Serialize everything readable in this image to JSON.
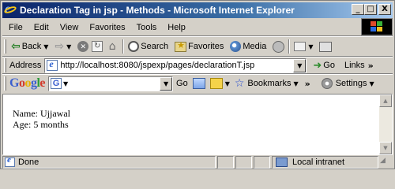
{
  "window": {
    "title": "Declaration Tag in jsp - Methods - Microsoft Internet Explorer",
    "minimize_glyph": "_",
    "maximize_glyph": "□",
    "close_glyph": "X"
  },
  "menu": {
    "items": [
      "File",
      "Edit",
      "View",
      "Favorites",
      "Tools",
      "Help"
    ]
  },
  "toolbar": {
    "back_label": "Back",
    "search_label": "Search",
    "favorites_label": "Favorites",
    "media_label": "Media"
  },
  "address_bar": {
    "label": "Address",
    "url": "http://localhost:8080/jspexp/pages/declarationT.jsp",
    "go_label": "Go",
    "links_label": "Links"
  },
  "google_toolbar": {
    "logo_letters": [
      "G",
      "o",
      "o",
      "g",
      "l",
      "e"
    ],
    "search_icon_letter": "G",
    "go_label": "Go",
    "bookmarks_label": "Bookmarks",
    "settings_label": "Settings"
  },
  "page": {
    "lines": [
      "Name: Ujjawal",
      "Age: 5 months"
    ]
  },
  "status_bar": {
    "status_text": "Done",
    "zone_text": "Local intranet"
  },
  "icons": {
    "back": "back-arrow-icon",
    "forward": "forward-arrow-icon",
    "stop": "stop-icon",
    "refresh": "refresh-icon",
    "home": "home-icon",
    "search": "search-icon",
    "favorites": "favorites-icon",
    "media": "media-icon",
    "history": "history-icon",
    "mail": "mail-icon",
    "print": "print-icon",
    "bookmarks": "star-icon",
    "settings": "settings-gear-icon"
  },
  "colors": {
    "titlebar_start": "#0a246a",
    "titlebar_end": "#a6caf0",
    "chrome": "#d4d0c8"
  }
}
